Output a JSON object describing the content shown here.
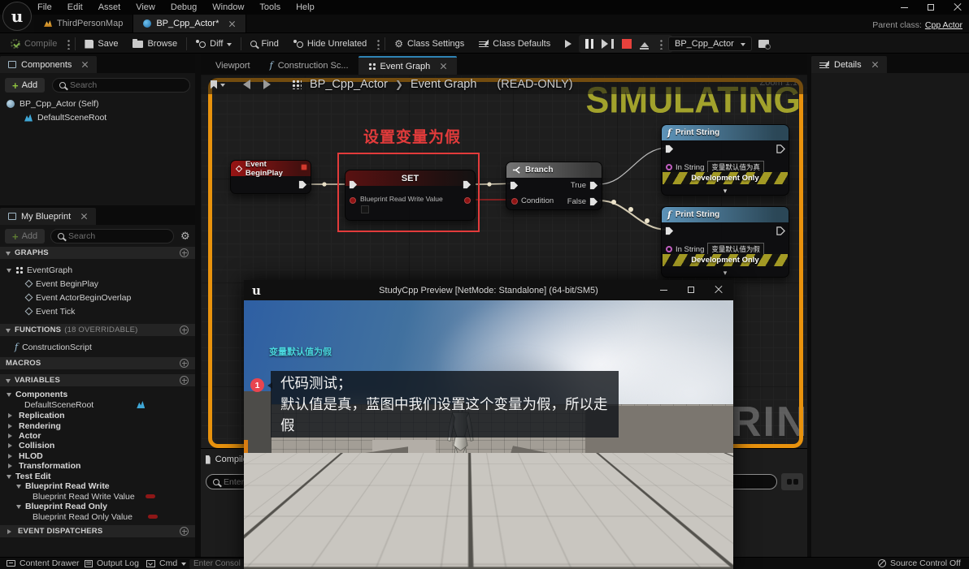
{
  "window": {
    "menu": [
      "File",
      "Edit",
      "Asset",
      "View",
      "Debug",
      "Window",
      "Tools",
      "Help"
    ],
    "parent_class_label": "Parent class:",
    "parent_class": "Cpp Actor"
  },
  "asset_tabs": {
    "map_tab": "ThirdPersonMap",
    "blueprint_tab": "BP_Cpp_Actor*"
  },
  "toolbar": {
    "compile": "Compile",
    "save": "Save",
    "browse": "Browse",
    "diff": "Diff",
    "find": "Find",
    "hide_unrelated": "Hide Unrelated",
    "class_settings": "Class Settings",
    "class_defaults": "Class Defaults",
    "simulation": "Simulation",
    "debug_object": "BP_Cpp_Actor"
  },
  "components_panel": {
    "title": "Components",
    "add": "Add",
    "search_placeholder": "Search",
    "root": "BP_Cpp_Actor (Self)",
    "child": "DefaultSceneRoot"
  },
  "my_blueprint": {
    "title": "My Blueprint",
    "add": "Add",
    "search_placeholder": "Search",
    "graphs_header": "GRAPHS",
    "event_graph": "EventGraph",
    "events": [
      "Event BeginPlay",
      "Event ActorBeginOverlap",
      "Event Tick"
    ],
    "functions_header": "FUNCTIONS",
    "functions_note": "(18 OVERRIDABLE)",
    "construction_script": "ConstructionScript",
    "macros_header": "MACROS",
    "variables_header": "VARIABLES",
    "var_components": "Components",
    "var_default_scene_root": "DefaultSceneRoot",
    "var_categories": [
      "Replication",
      "Rendering",
      "Actor",
      "Collision",
      "HLOD",
      "Transformation"
    ],
    "test_edit": "Test Edit",
    "brw_group": "Blueprint Read Write",
    "brw_value": "Blueprint Read Write Value",
    "bro_group": "Blueprint Read Only",
    "bro_value": "Blueprint Read Only Value",
    "event_dispatchers_header": "EVENT DISPATCHERS"
  },
  "graph": {
    "tabs": {
      "viewport": "Viewport",
      "construction": "Construction Sc...",
      "event_graph": "Event Graph"
    },
    "breadcrumb": {
      "root": "BP_Cpp_Actor",
      "current": "Event Graph",
      "readonly": "(READ-ONLY)"
    },
    "zoom_level": "Zoom 1:1",
    "simulating_watermark": "SIMULATING",
    "print_watermark": "RINT",
    "comment_text": "设置变量为假",
    "begin_play": {
      "title": "Event BeginPlay"
    },
    "set_node": {
      "title": "SET",
      "pin": "Blueprint Read Write Value"
    },
    "branch": {
      "title": "Branch",
      "condition": "Condition",
      "true_pin": "True",
      "false_pin": "False"
    },
    "print_true": {
      "title": "Print String",
      "pin": "In String",
      "value": "变量默认值为真",
      "dev_only": "Development Only"
    },
    "print_false": {
      "title": "Print String",
      "pin": "In String",
      "value": "变量默认值为假",
      "dev_only": "Development Only"
    },
    "results_tab": "Compile",
    "results_search_placeholder": "Enter t"
  },
  "details_panel": {
    "title": "Details"
  },
  "preview": {
    "title": "StudyCpp Preview [NetMode: Standalone]  (64-bit/SM5)",
    "debug_message": "变量默认值为假",
    "badge": "1",
    "note_line1": "代码测试；",
    "note_line2": "默认值是真，蓝图中我们设置这个变量为假，所以走假"
  },
  "status_bar": {
    "content_drawer": "Content Drawer",
    "output_log": "Output Log",
    "cmd": "Cmd",
    "console_placeholder": "Enter Consol",
    "source_control": "Source Control Off"
  },
  "colors": {
    "simulate_border": "#E8920D",
    "simulating_text": "#AAAA2D",
    "node_event_red": "#971414",
    "node_branch_gray": "#747474",
    "node_print_blue": "#5D93B8",
    "wire_exec": "#D5CCB4",
    "wire_bool": "#A32222",
    "annotation_red": "#E23B3B",
    "debug_cyan": "#49D6DE",
    "accent_green": "#8FC43F"
  }
}
